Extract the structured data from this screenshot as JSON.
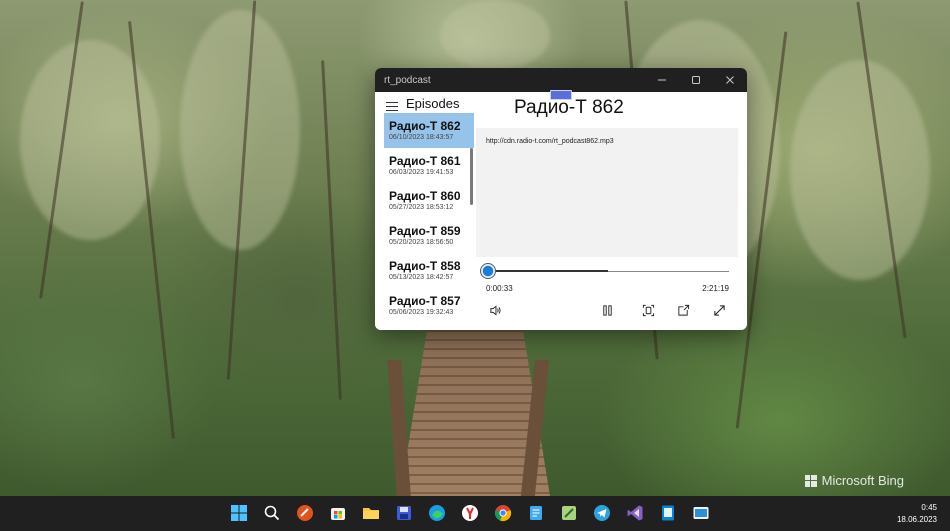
{
  "desktop": {
    "watermark": "Microsoft Bing"
  },
  "window": {
    "title": "rt_podcast"
  },
  "pane": {
    "title": "Episodes",
    "episodes": [
      {
        "title": "Радио-Т 862",
        "date": "06/10/2023 18:43:57",
        "selected": true
      },
      {
        "title": "Радио-Т 861",
        "date": "06/03/2023 19:41:53",
        "selected": false
      },
      {
        "title": "Радио-Т 860",
        "date": "05/27/2023 18:53:12",
        "selected": false
      },
      {
        "title": "Радио-Т 859",
        "date": "05/20/2023 18:56:50",
        "selected": false
      },
      {
        "title": "Радио-Т 858",
        "date": "05/13/2023 18:42:57",
        "selected": false
      },
      {
        "title": "Радио-Т 857",
        "date": "05/06/2023 19:32:43",
        "selected": false
      }
    ]
  },
  "player": {
    "episode_title": "Радио-Т 862",
    "url": "http://cdn.radio-t.com/rt_podcast862.mp3",
    "elapsed": "0:00:33",
    "duration": "2:21:19",
    "progress_fraction": 0.004,
    "buffered_fraction": 0.5
  },
  "taskbar": {
    "icons": [
      "windows-start-icon",
      "search-icon",
      "app-icon-orange",
      "microsoft-store-icon",
      "file-explorer-icon",
      "save-app-icon",
      "edge-icon",
      "yandex-browser-icon",
      "chrome-icon",
      "notepad-icon",
      "excel-like-icon",
      "telegram-icon",
      "visual-studio-icon",
      "windows-app-icon",
      "photos-app-icon"
    ],
    "time": "0:45",
    "date": "18.06.2023"
  },
  "colors": {
    "selected_item": "#96c3ea",
    "accent": "#1a7dd6",
    "titlebar": "#202020",
    "taskbar": "#202020"
  }
}
